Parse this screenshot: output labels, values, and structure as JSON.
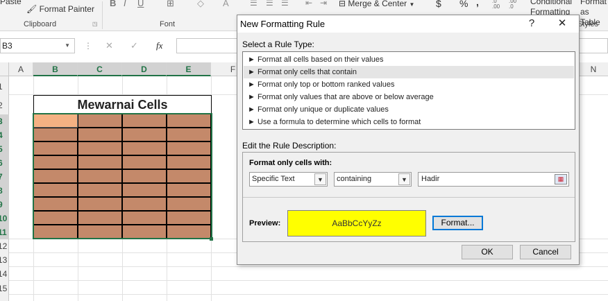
{
  "ribbon": {
    "paste_label": "Paste",
    "format_painter_label": "Format Painter",
    "clipboard_group": "Clipboard",
    "font_group": "Font",
    "bold_label": "B",
    "italic_label": "I",
    "underline_label": "U",
    "font_color_label": "A",
    "merge_center_label": "Merge & Center",
    "currency_label": "$",
    "percent_label": "%",
    "comma_label": ",",
    "conditional_formatting_label": "Conditional Formatting",
    "format_as_table_label": "Format as Table",
    "styles_group": "Styles"
  },
  "formula_bar": {
    "name_box": "B3",
    "fx_label": "fx",
    "cancel_label": "✕",
    "enter_label": "✓",
    "formula_value": ""
  },
  "sheet": {
    "columns": [
      "A",
      "B",
      "C",
      "D",
      "E",
      "F",
      "N"
    ],
    "rows": [
      "1",
      "2",
      "3",
      "4",
      "5",
      "6",
      "7",
      "8",
      "9",
      "10",
      "11",
      "12",
      "13",
      "14",
      "15"
    ],
    "title_text": "Mewarnai Cells",
    "cell_color": "#c4896a",
    "active_cell_color": "#f4b183",
    "selection_color": "#217346"
  },
  "dialog": {
    "title": "New Formatting Rule",
    "help_label": "?",
    "close_label": "✕",
    "select_rule_type_label": "Select a Rule Type:",
    "rule_types": [
      "Format all cells based on their values",
      "Format only cells that contain",
      "Format only top or bottom ranked values",
      "Format only values that are above or below average",
      "Format only unique or duplicate values",
      "Use a formula to determine which cells to format"
    ],
    "selected_rule_index": 1,
    "edit_description_label": "Edit the Rule Description:",
    "format_only_cells_with_label": "Format only cells with:",
    "condition_type_value": "Specific Text",
    "operator_value": "containing",
    "text_value": "Hadir",
    "preview_label": "Preview:",
    "preview_sample": "AaBbCcYyZz",
    "preview_color": "#ffff00",
    "format_button": "Format...",
    "ok_button": "OK",
    "cancel_button": "Cancel"
  }
}
